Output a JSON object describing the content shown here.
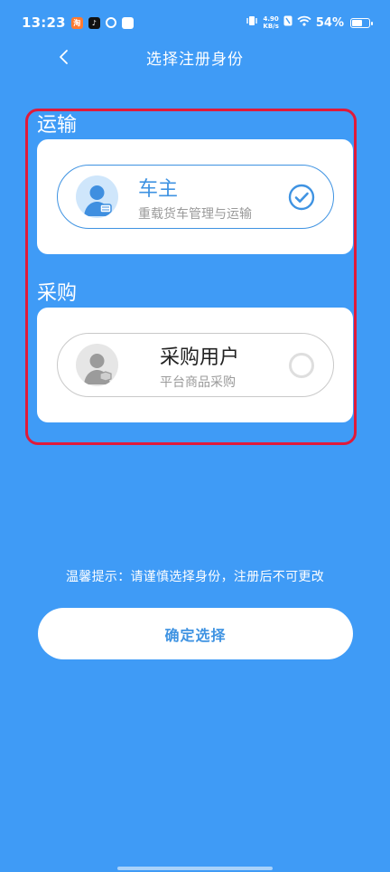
{
  "status_bar": {
    "time": "13:23",
    "net_speed_value": "4.90",
    "net_speed_unit": "KB/s",
    "battery": "54%",
    "app_icons": [
      "app-red-icon",
      "tiktok-icon",
      "loop-icon",
      "box-icon"
    ]
  },
  "nav": {
    "title": "选择注册身份",
    "back_icon": "chevron-left-icon"
  },
  "sections": [
    {
      "title": "运输",
      "option": {
        "label": "车主",
        "subtitle": "重载货车管理与运输",
        "selected": true
      }
    },
    {
      "title": "采购",
      "option": {
        "label": "采购用户",
        "subtitle": "平台商品采购",
        "selected": false
      }
    }
  ],
  "tip": "温馨提示：请谨慎选择身份，注册后不可更改",
  "confirm_label": "确定选择",
  "colors": {
    "background": "#3f9bf6",
    "accent": "#3f93e2",
    "highlight_border": "#e01a3a"
  }
}
